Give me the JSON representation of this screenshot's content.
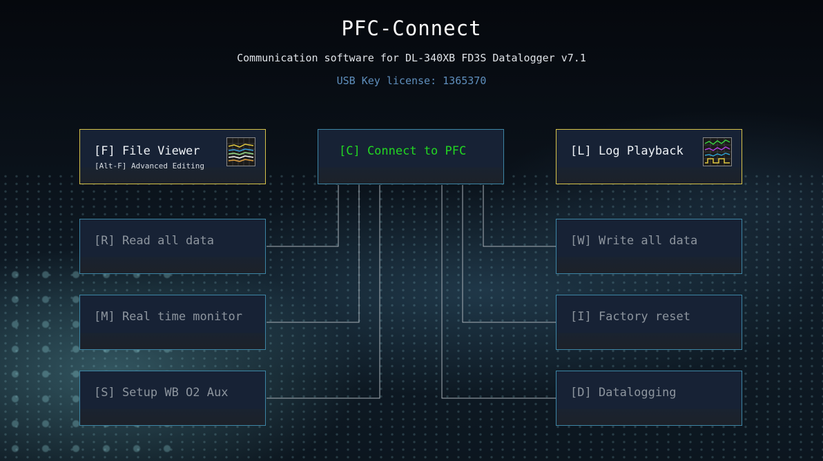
{
  "header": {
    "title": "PFC-Connect",
    "subtitle": "Communication software for DL-340XB FD3S Datalogger v7.1",
    "license": "USB Key license: 1365370"
  },
  "menu": {
    "file_viewer": {
      "label": "[F] File Viewer",
      "sublabel": "[Alt-F] Advanced Editing",
      "icon": "chart-thumbnail-icon"
    },
    "connect": {
      "label": "[C] Connect to PFC"
    },
    "log_playback": {
      "label": "[L] Log Playback",
      "icon": "waveform-thumbnail-icon"
    },
    "read_all": {
      "label": "[R] Read all data"
    },
    "write_all": {
      "label": "[W] Write all data"
    },
    "realtime": {
      "label": "[M] Real time monitor"
    },
    "factory_reset": {
      "label": "[I] Factory reset"
    },
    "setup_wb": {
      "label": "[S] Setup WB O2 Aux"
    },
    "datalogging": {
      "label": "[D] Datalogging"
    }
  },
  "colors": {
    "accent_green": "#22d622",
    "license_blue": "#5f8fbd",
    "highlight_border": "#d8c44a",
    "box_border": "#3d86a6",
    "connector_line": "#a9b1b8"
  }
}
